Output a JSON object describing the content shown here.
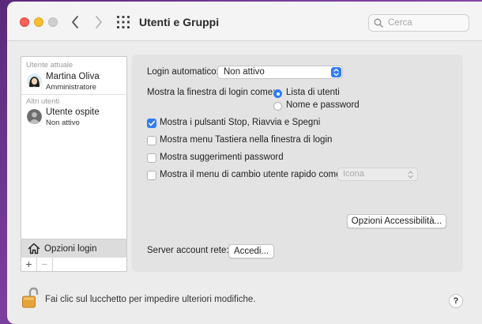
{
  "window": {
    "title": "Utenti e Gruppi",
    "search": {
      "placeholder": "Cerca",
      "value": ""
    }
  },
  "sidebar": {
    "current_users_label": "Utente attuale",
    "current_user": {
      "name": "Martina Oliva",
      "role": "Amministratore"
    },
    "other_users_label": "Altri utenti",
    "other_user": {
      "name": "Utente ospite",
      "status": "Non attivo"
    },
    "login_options_label": "Opzioni login",
    "add_label": "+",
    "remove_label": "−"
  },
  "main": {
    "auto_login_label": "Login automatico:",
    "auto_login_value": "Non attivo",
    "show_login_window_label": "Mostra la finestra di login come:",
    "radio_list": {
      "label": "Lista di utenti",
      "selected": true
    },
    "radio_name_pw": {
      "label": "Nome e password",
      "selected": false
    },
    "checkboxes": [
      {
        "label": "Mostra i pulsanti Stop, Riavvia e Spegni",
        "checked": true
      },
      {
        "label": "Mostra menu Tastiera nella finestra di login",
        "checked": false
      },
      {
        "label": "Mostra suggerimenti password",
        "checked": false
      },
      {
        "label": "Mostra il menu di cambio utente rapido come",
        "checked": false
      }
    ],
    "fast_switch_value": "Icona",
    "accessibility_button": "Opzioni Accessibilità...",
    "network_server_label": "Server account rete:",
    "join_button": "Accedi..."
  },
  "footer": {
    "lock_text": "Fai clic sul lucchetto per impedire ulteriori modifiche.",
    "help_label": "?"
  },
  "colors": {
    "accent": "#2f7cf6",
    "close": "#fe5f57",
    "minimize": "#febc2e",
    "zoom_disabled": "#cfcfcf"
  }
}
